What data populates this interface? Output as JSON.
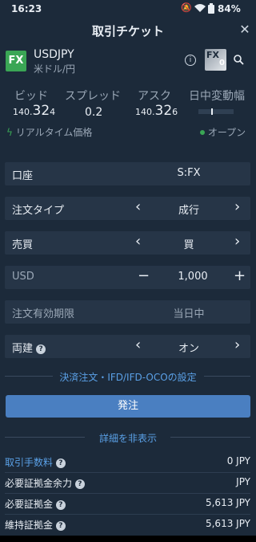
{
  "status_bar": {
    "time": "16:23",
    "battery": "84%"
  },
  "header": {
    "title": "取引チケット"
  },
  "instrument": {
    "badge": "FX",
    "symbol": "USDJPY",
    "name": "米ドル/円",
    "fx_tile": "FX",
    "fx_tile_sub": "0"
  },
  "quote": {
    "bid_label": "ビッド",
    "spread_label": "スプレッド",
    "ask_label": "アスク",
    "range_label": "日中変動幅",
    "bid_prefix": "140.",
    "bid_big": "32",
    "bid_small": "4",
    "spread_value": "0.2",
    "ask_prefix": "140.",
    "ask_big": "32",
    "ask_small": "6",
    "realtime_label": "リアルタイム価格",
    "market_status": "オープン"
  },
  "form": {
    "account_label": "口座",
    "account_value": "S:FX",
    "order_type_label": "注文タイプ",
    "order_type_value": "成行",
    "side_label": "売買",
    "side_value": "買",
    "qty_label": "USD",
    "qty_value": "1,000",
    "expiry_label": "注文有効期限",
    "expiry_value": "当日中",
    "hedge_label": "両建",
    "hedge_value": "オン"
  },
  "links": {
    "settle_order": "決済注文・IFD/IFD-OCOの設定",
    "hide_details": "詳細を非表示"
  },
  "buttons": {
    "order": "発注"
  },
  "details": [
    {
      "label": "取引手数料",
      "value": "0 JPY"
    },
    {
      "label": "必要証拠金余力",
      "value": "JPY"
    },
    {
      "label": "必要証拠金",
      "value": "5,613 JPY"
    },
    {
      "label": "維持証拠金",
      "value": "5,613 JPY"
    }
  ],
  "colors": {
    "background": "#1c2a3a",
    "row": "#263547",
    "accent_blue": "#4a7fc1",
    "green": "#3aa655"
  }
}
